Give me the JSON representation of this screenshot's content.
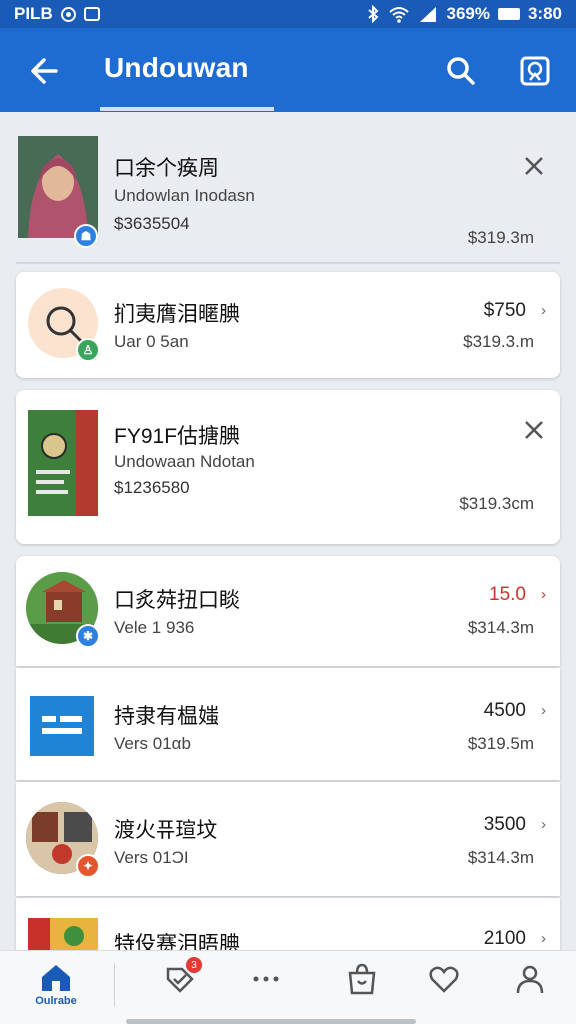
{
  "status_bar": {
    "left_text": "PILB",
    "right_text": "369%",
    "time": "3:80"
  },
  "app_bar": {
    "title": "Undouwan"
  },
  "items": [
    {
      "title": "口余个痪周",
      "subtitle": "Undowlan Inodasn",
      "meta": "$3635504",
      "price": "",
      "amount": "$319.3m",
      "trailing": "close-icon",
      "badge": "blue"
    },
    {
      "title": "扪夷膺泪暱腆",
      "subtitle": "Uar 0 5an",
      "meta": "",
      "price": "$750",
      "amount": "$319.3.m",
      "trailing": "chevron-right-icon",
      "badge": "green"
    },
    {
      "title": "FY91F估搪腆",
      "subtitle": "Undowaan Ndotan",
      "meta": "$1236580",
      "price": "",
      "amount": "$319.3cm",
      "trailing": "close-icon",
      "badge": "none"
    },
    {
      "title": "口炙荈扭口睒",
      "subtitle": "Vele 1 936",
      "meta": "",
      "price": "15.0",
      "price_red": true,
      "amount": "$314.3m",
      "trailing": "chevron-right-icon",
      "badge": "blue"
    },
    {
      "title": "持隶有榅媸",
      "subtitle": "Vers 01αb",
      "meta": "",
      "price": "4500",
      "amount": "$319.5m",
      "trailing": "chevron-right-icon",
      "badge": "none"
    },
    {
      "title": "渡火퓨瑄坟",
      "subtitle": "Vers 01ƆI",
      "meta": "",
      "price": "3500",
      "amount": "$314.3m",
      "trailing": "chevron-right-icon",
      "badge": "orange"
    },
    {
      "title": "特伇赛泪晤腆",
      "subtitle": "",
      "meta": "",
      "price": "2100",
      "amount": "",
      "trailing": "chevron-right-icon",
      "badge": "none"
    }
  ],
  "bottom_nav": {
    "home_label": "Oulrabe",
    "orders_badge": "3"
  },
  "colors": {
    "primary": "#1e6bd2",
    "status": "#1a5bb8",
    "accent_red": "#d0322c"
  }
}
